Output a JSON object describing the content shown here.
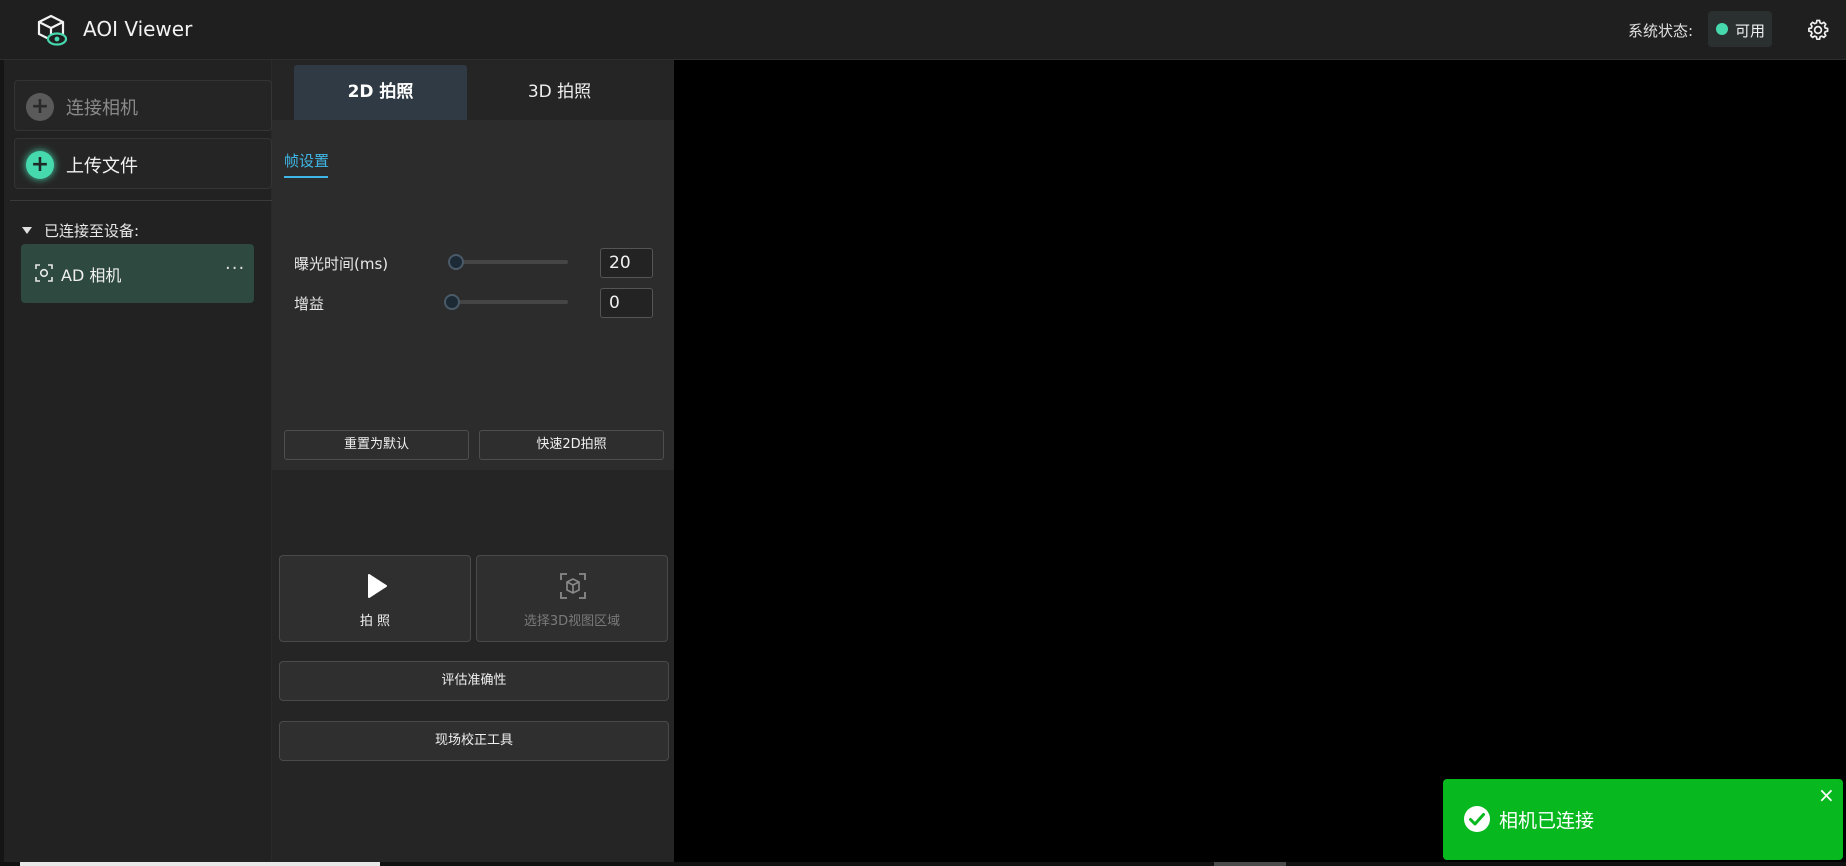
{
  "app": {
    "title": "AOI Viewer"
  },
  "status": {
    "label": "系统状态:",
    "value": "可用",
    "color": "#46d9ad"
  },
  "sidebar": {
    "connect_camera": "连接相机",
    "upload_file": "上传文件",
    "connected_header": "已连接至设备:",
    "device": {
      "name": "AD 相机",
      "more": "···"
    }
  },
  "panel": {
    "tabs": [
      {
        "label": "2D 拍照"
      },
      {
        "label": "3D 拍照"
      }
    ],
    "subtab": "帧设置",
    "exposure": {
      "label": "曝光时间(ms)",
      "value": "20"
    },
    "gain": {
      "label": "增益",
      "value": "0"
    },
    "reset_label": "重置为默认",
    "quick_label": "快速2D拍照",
    "capture_label": "拍 照",
    "select3d_label": "选择3D视图区域",
    "evaluate_label": "评估准确性",
    "calib_label": "现场校正工具"
  },
  "toast": {
    "message": "相机已连接",
    "close": "×"
  },
  "colors": {
    "accent": "#3fb7e6",
    "toast_green": "#08b81f",
    "device_bg": "#2e4a40"
  }
}
